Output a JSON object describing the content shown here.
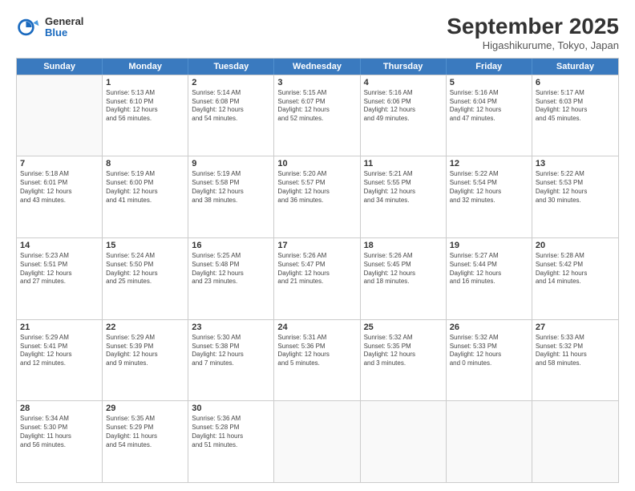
{
  "logo": {
    "general": "General",
    "blue": "Blue"
  },
  "title": "September 2025",
  "location": "Higashikurume, Tokyo, Japan",
  "headers": [
    "Sunday",
    "Monday",
    "Tuesday",
    "Wednesday",
    "Thursday",
    "Friday",
    "Saturday"
  ],
  "weeks": [
    [
      {
        "day": "",
        "info": ""
      },
      {
        "day": "1",
        "info": "Sunrise: 5:13 AM\nSunset: 6:10 PM\nDaylight: 12 hours\nand 56 minutes."
      },
      {
        "day": "2",
        "info": "Sunrise: 5:14 AM\nSunset: 6:08 PM\nDaylight: 12 hours\nand 54 minutes."
      },
      {
        "day": "3",
        "info": "Sunrise: 5:15 AM\nSunset: 6:07 PM\nDaylight: 12 hours\nand 52 minutes."
      },
      {
        "day": "4",
        "info": "Sunrise: 5:16 AM\nSunset: 6:06 PM\nDaylight: 12 hours\nand 49 minutes."
      },
      {
        "day": "5",
        "info": "Sunrise: 5:16 AM\nSunset: 6:04 PM\nDaylight: 12 hours\nand 47 minutes."
      },
      {
        "day": "6",
        "info": "Sunrise: 5:17 AM\nSunset: 6:03 PM\nDaylight: 12 hours\nand 45 minutes."
      }
    ],
    [
      {
        "day": "7",
        "info": "Sunrise: 5:18 AM\nSunset: 6:01 PM\nDaylight: 12 hours\nand 43 minutes."
      },
      {
        "day": "8",
        "info": "Sunrise: 5:19 AM\nSunset: 6:00 PM\nDaylight: 12 hours\nand 41 minutes."
      },
      {
        "day": "9",
        "info": "Sunrise: 5:19 AM\nSunset: 5:58 PM\nDaylight: 12 hours\nand 38 minutes."
      },
      {
        "day": "10",
        "info": "Sunrise: 5:20 AM\nSunset: 5:57 PM\nDaylight: 12 hours\nand 36 minutes."
      },
      {
        "day": "11",
        "info": "Sunrise: 5:21 AM\nSunset: 5:55 PM\nDaylight: 12 hours\nand 34 minutes."
      },
      {
        "day": "12",
        "info": "Sunrise: 5:22 AM\nSunset: 5:54 PM\nDaylight: 12 hours\nand 32 minutes."
      },
      {
        "day": "13",
        "info": "Sunrise: 5:22 AM\nSunset: 5:53 PM\nDaylight: 12 hours\nand 30 minutes."
      }
    ],
    [
      {
        "day": "14",
        "info": "Sunrise: 5:23 AM\nSunset: 5:51 PM\nDaylight: 12 hours\nand 27 minutes."
      },
      {
        "day": "15",
        "info": "Sunrise: 5:24 AM\nSunset: 5:50 PM\nDaylight: 12 hours\nand 25 minutes."
      },
      {
        "day": "16",
        "info": "Sunrise: 5:25 AM\nSunset: 5:48 PM\nDaylight: 12 hours\nand 23 minutes."
      },
      {
        "day": "17",
        "info": "Sunrise: 5:26 AM\nSunset: 5:47 PM\nDaylight: 12 hours\nand 21 minutes."
      },
      {
        "day": "18",
        "info": "Sunrise: 5:26 AM\nSunset: 5:45 PM\nDaylight: 12 hours\nand 18 minutes."
      },
      {
        "day": "19",
        "info": "Sunrise: 5:27 AM\nSunset: 5:44 PM\nDaylight: 12 hours\nand 16 minutes."
      },
      {
        "day": "20",
        "info": "Sunrise: 5:28 AM\nSunset: 5:42 PM\nDaylight: 12 hours\nand 14 minutes."
      }
    ],
    [
      {
        "day": "21",
        "info": "Sunrise: 5:29 AM\nSunset: 5:41 PM\nDaylight: 12 hours\nand 12 minutes."
      },
      {
        "day": "22",
        "info": "Sunrise: 5:29 AM\nSunset: 5:39 PM\nDaylight: 12 hours\nand 9 minutes."
      },
      {
        "day": "23",
        "info": "Sunrise: 5:30 AM\nSunset: 5:38 PM\nDaylight: 12 hours\nand 7 minutes."
      },
      {
        "day": "24",
        "info": "Sunrise: 5:31 AM\nSunset: 5:36 PM\nDaylight: 12 hours\nand 5 minutes."
      },
      {
        "day": "25",
        "info": "Sunrise: 5:32 AM\nSunset: 5:35 PM\nDaylight: 12 hours\nand 3 minutes."
      },
      {
        "day": "26",
        "info": "Sunrise: 5:32 AM\nSunset: 5:33 PM\nDaylight: 12 hours\nand 0 minutes."
      },
      {
        "day": "27",
        "info": "Sunrise: 5:33 AM\nSunset: 5:32 PM\nDaylight: 11 hours\nand 58 minutes."
      }
    ],
    [
      {
        "day": "28",
        "info": "Sunrise: 5:34 AM\nSunset: 5:30 PM\nDaylight: 11 hours\nand 56 minutes."
      },
      {
        "day": "29",
        "info": "Sunrise: 5:35 AM\nSunset: 5:29 PM\nDaylight: 11 hours\nand 54 minutes."
      },
      {
        "day": "30",
        "info": "Sunrise: 5:36 AM\nSunset: 5:28 PM\nDaylight: 11 hours\nand 51 minutes."
      },
      {
        "day": "",
        "info": ""
      },
      {
        "day": "",
        "info": ""
      },
      {
        "day": "",
        "info": ""
      },
      {
        "day": "",
        "info": ""
      }
    ]
  ]
}
